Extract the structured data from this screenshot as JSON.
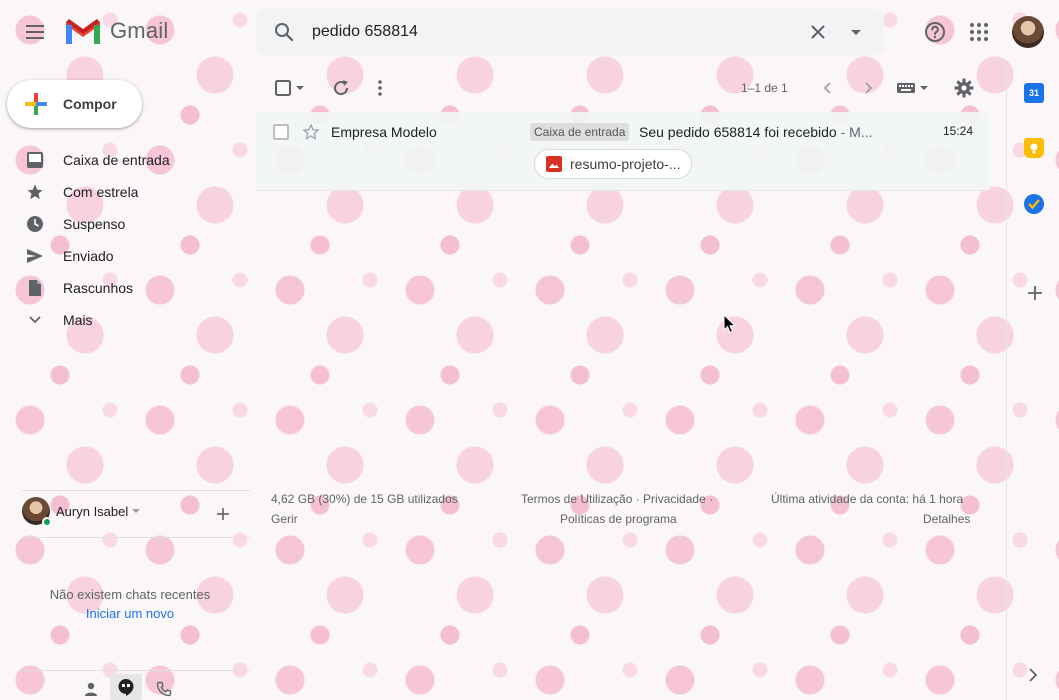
{
  "header": {
    "logo_text": "Gmail",
    "search_value": "pedido 658814"
  },
  "compose": {
    "label": "Compor"
  },
  "nav": {
    "items": [
      {
        "label": "Caixa de entrada",
        "icon": "inbox-icon"
      },
      {
        "label": "Com estrela",
        "icon": "star-icon"
      },
      {
        "label": "Suspenso",
        "icon": "clock-icon"
      },
      {
        "label": "Enviado",
        "icon": "send-icon"
      },
      {
        "label": "Rascunhos",
        "icon": "draft-icon"
      },
      {
        "label": "Mais",
        "icon": "chevron-down-icon"
      }
    ]
  },
  "toolbar": {
    "count": "1–1 de 1"
  },
  "email": {
    "sender": "Empresa Modelo",
    "label": "Caixa de entrada",
    "subject": "Seu pedido 658814 foi recebido",
    "snippet": " - M...",
    "time": "15:24",
    "attachment": "resumo-projeto-..."
  },
  "footer": {
    "storage": "4,62 GB (30%) de 15 GB utilizados",
    "manage": "Gerir",
    "terms": "Termos de Utilização",
    "sep1": " · ",
    "privacy": "Privacidade",
    "sep2": " ·",
    "policies": "Políticas de programa",
    "activity": "Última atividade da conta: há 1 hora",
    "details": "Detalhes"
  },
  "chat": {
    "user_name": "Auryn Isabel",
    "empty_text": "Não existem chats recentes",
    "start_link": "Iniciar um novo"
  },
  "side_panel": {
    "calendar_day": "31"
  },
  "colors": {
    "brand_red": "#ea4335",
    "brand_blue": "#4285f4",
    "brand_yellow": "#fbbc04",
    "brand_green": "#34a853",
    "link_blue": "#1a73e8",
    "online_green": "#0f9d58"
  }
}
